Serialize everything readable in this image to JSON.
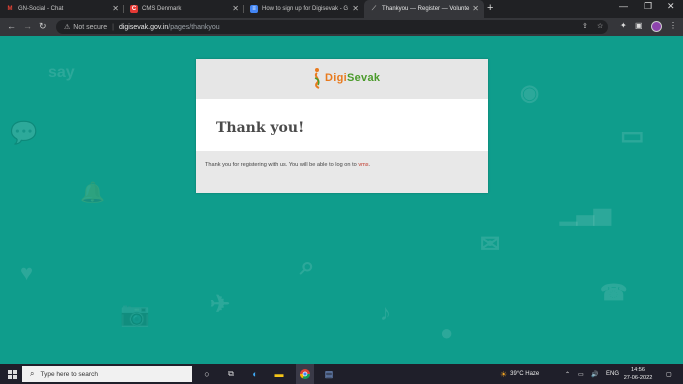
{
  "browser": {
    "tabs": [
      {
        "title": "GN-Social - Chat",
        "icon": "gmail-icon",
        "active": false
      },
      {
        "title": "CMS Denmark",
        "icon": "cms-icon",
        "active": false
      },
      {
        "title": "How to sign up for Digisevak - G",
        "icon": "docs-icon",
        "active": false
      },
      {
        "title": "Thankyou — Register — Volunte",
        "icon": "page-icon",
        "active": true
      }
    ],
    "new_tab": "+",
    "address": {
      "security": "Not secure",
      "host": "digisevak.gov.in",
      "path": "/pages/thankyou"
    }
  },
  "page": {
    "logo": {
      "prefix": "Digi",
      "suffix": "Sevak"
    },
    "title": "Thank you!",
    "message_prefix": "Thank you for registering with us. You will be able to log on to ",
    "message_link": "vms",
    "message_suffix": "."
  },
  "taskbar": {
    "search_placeholder": "Type here to search",
    "weather": "39°C  Haze",
    "language": "ENG",
    "time": "14:56",
    "date": "27-06-2022"
  },
  "colors": {
    "background": "#0f9d8c",
    "logo_orange": "#e87a1e",
    "logo_green": "#4a9a2a",
    "link": "#c0392b"
  }
}
